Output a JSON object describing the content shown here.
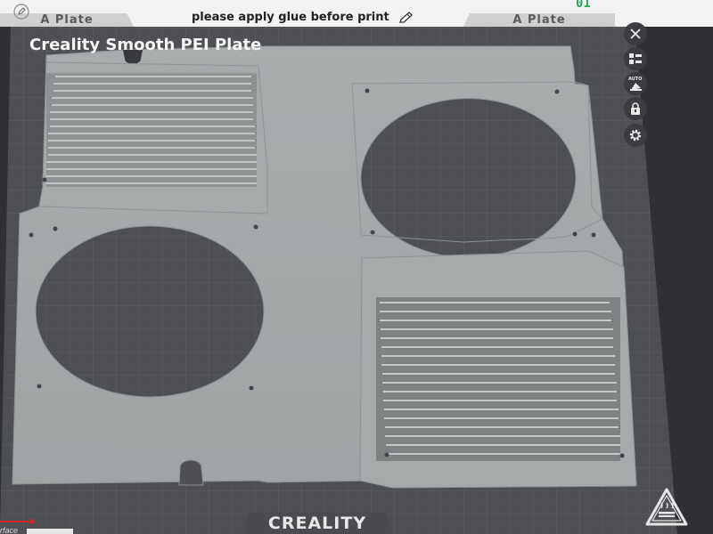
{
  "top_bar": {
    "plate_left_label": "A Plate",
    "plate_right_label": "A Plate",
    "glue_note": "please apply glue before print",
    "plate_number": "01"
  },
  "bed": {
    "title": "Creality Smooth PEI Plate",
    "logo": "CREALITY",
    "corner_fragment": "rface"
  },
  "toolbar": {
    "auto_label": "AUTO"
  },
  "colors": {
    "accent_green": "#2aa65a",
    "bed_surface": "#4e4f52",
    "grid_line": "#5e5f62",
    "part_fill": "#a9aeae"
  },
  "icons": [
    "edit-icon",
    "pencil-icon",
    "close-icon",
    "arrange-icon",
    "auto-orient-icon",
    "lock-icon",
    "gear-icon",
    "heated-bed-warning-icon",
    "axis-arrow-icon"
  ]
}
